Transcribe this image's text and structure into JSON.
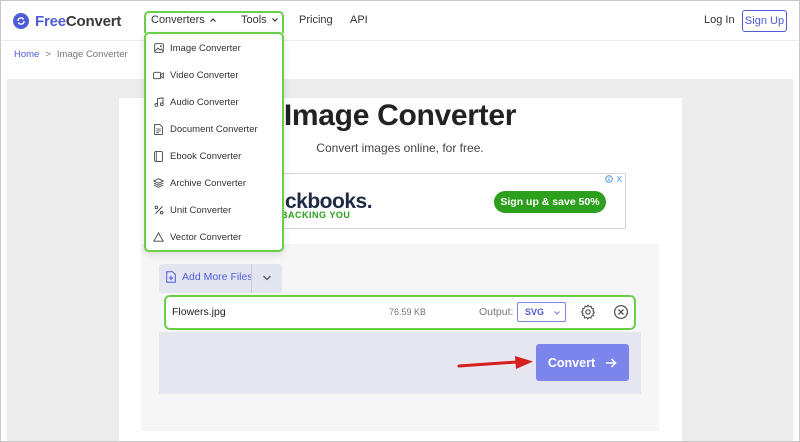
{
  "header": {
    "logo_text_a": "Free",
    "logo_text_b": "Convert",
    "nav": {
      "converters": "Converters",
      "tools": "Tools",
      "pricing": "Pricing",
      "api": "API"
    },
    "login": "Log In",
    "signup": "Sign Up"
  },
  "breadcrumb": {
    "home": "Home",
    "separator": ">",
    "current": "Image Converter"
  },
  "menu": {
    "items": [
      {
        "label": "Image Converter",
        "icon": "image-icon"
      },
      {
        "label": "Video Converter",
        "icon": "video-icon"
      },
      {
        "label": "Audio Converter",
        "icon": "audio-icon"
      },
      {
        "label": "Document Converter",
        "icon": "document-icon"
      },
      {
        "label": "Ebook Converter",
        "icon": "ebook-icon"
      },
      {
        "label": "Archive Converter",
        "icon": "archive-icon"
      },
      {
        "label": "Unit Converter",
        "icon": "percent-icon"
      },
      {
        "label": "Vector Converter",
        "icon": "triangle-icon"
      }
    ]
  },
  "page": {
    "title": "Image Converter",
    "subtitle": "Convert images online, for free."
  },
  "ad": {
    "brand": "quickbooks.",
    "tagline": "BACKING YOU",
    "cta": "Sign up & save 50%",
    "close": "X"
  },
  "uploader": {
    "add_more": "Add More Files",
    "file": {
      "name": "Flowers.jpg",
      "size": "76.59 KB",
      "output_label": "Output:",
      "output_value": "SVG"
    },
    "convert": "Convert"
  },
  "colors": {
    "brand": "#4f5bd5",
    "highlight": "#67d046",
    "ad_green": "#2ca01c",
    "convert_button": "#7b85ec"
  }
}
